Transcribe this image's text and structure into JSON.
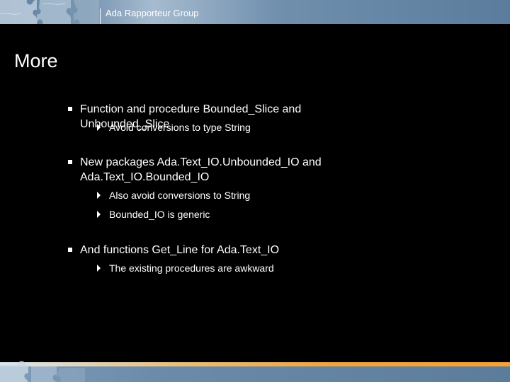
{
  "header": {
    "org": "Ada Rapporteur Group"
  },
  "slide": {
    "title": "More"
  },
  "bullets": [
    {
      "text": "Function and procedure Bounded_Slice and Unbounded_Slice",
      "sub": [
        "Avoid conversions to type String"
      ]
    },
    {
      "text_line1": "New packages Ada.Text_IO.Unbounded_IO and",
      "text_line2": "Ada.Text_IO.Bounded_IO",
      "sub": [
        "Also avoid conversions to String",
        "Bounded_IO is generic"
      ]
    },
    {
      "text": "And functions Get_Line for Ada.Text_IO",
      "sub": [
        "The existing procedures are awkward"
      ]
    }
  ],
  "icons": {
    "square_bullet": "square-bullet-icon",
    "arrow_bullet": "triangle-arrow-icon",
    "header_decoration": "puzzle-pieces-icon",
    "footer_decoration": "puzzle-pieces-icon"
  },
  "colors": {
    "background": "#000000",
    "text": "#ffffff",
    "header_blue": "#6f8fad",
    "footer_orange": "#f5a234"
  }
}
